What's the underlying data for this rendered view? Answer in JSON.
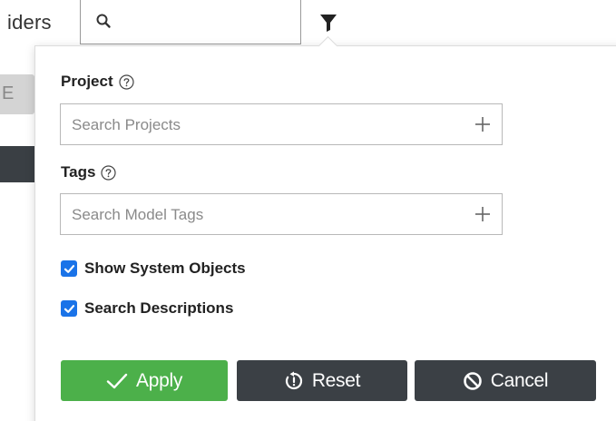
{
  "background": {
    "partial_label": "iders",
    "edit_partial": "E",
    "search_icon": "search-icon",
    "filter_icon": "filter-icon"
  },
  "filter_popover": {
    "project": {
      "label": "Project",
      "help_icon": "help-icon",
      "placeholder": "Search Projects",
      "add_icon": "plus-icon"
    },
    "tags": {
      "label": "Tags",
      "help_icon": "help-icon",
      "placeholder": "Search Model Tags",
      "add_icon": "plus-icon"
    },
    "options": [
      {
        "label": "Show System Objects",
        "checked": true
      },
      {
        "label": "Search Descriptions",
        "checked": true
      }
    ],
    "buttons": {
      "apply": "Apply",
      "reset": "Reset",
      "cancel": "Cancel"
    }
  },
  "colors": {
    "apply": "#4cb04a",
    "dark_button": "#3b4045",
    "checkbox": "#1a73e8"
  }
}
